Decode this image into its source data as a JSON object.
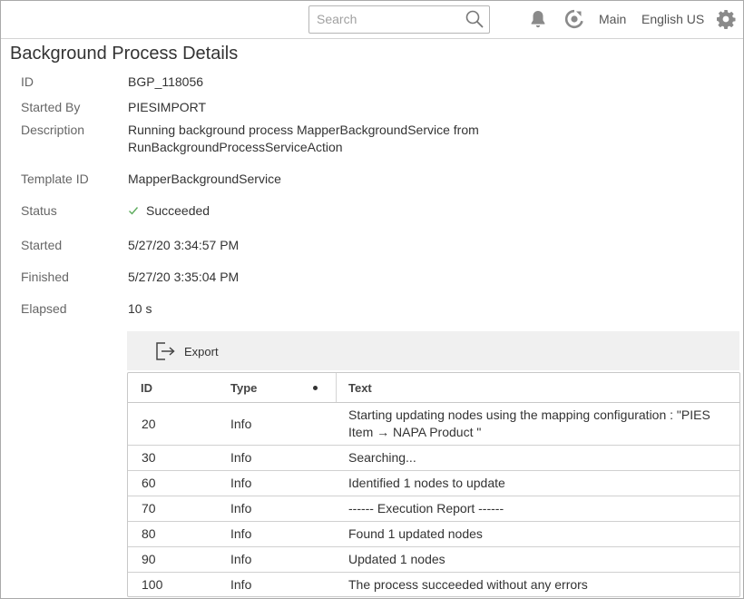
{
  "header": {
    "search_placeholder": "Search",
    "context_label": "Main",
    "language_label": "English US"
  },
  "icons": [
    "search-icon",
    "bell-icon",
    "refresh-icon",
    "gear-icon",
    "export-icon",
    "check-icon"
  ],
  "colors": {
    "success": "#5cab5c",
    "icon_gray": "#8a8a8a",
    "toolbar_bg": "#f0f0f0"
  },
  "page": {
    "title": "Background Process Details",
    "fields": {
      "id": {
        "label": "ID",
        "value": "BGP_118056"
      },
      "started_by": {
        "label": "Started By",
        "value": "PIESIMPORT"
      },
      "description": {
        "label": "Description",
        "line1": "Running background process MapperBackgroundService from",
        "line2": "RunBackgroundProcessServiceAction"
      },
      "template_id": {
        "label": "Template ID",
        "value": "MapperBackgroundService"
      },
      "status": {
        "label": "Status",
        "value": "Succeeded"
      },
      "started": {
        "label": "Started",
        "value": "5/27/20 3:34:57 PM"
      },
      "finished": {
        "label": "Finished",
        "value": "5/27/20 3:35:04 PM"
      },
      "elapsed": {
        "label": "Elapsed",
        "value": "10 s"
      }
    }
  },
  "toolbar": {
    "export_label": "Export"
  },
  "log_table": {
    "columns": [
      "ID",
      "Type",
      "Text"
    ],
    "rows": [
      {
        "id": "20",
        "type": "Info",
        "text_line1": "Starting updating nodes using the mapping configuration : \"PIES",
        "text_line2": "Item → NAPA Product \""
      },
      {
        "id": "30",
        "type": "Info",
        "text_line1": "Searching..."
      },
      {
        "id": "60",
        "type": "Info",
        "text_line1": "Identified 1 nodes to update"
      },
      {
        "id": "70",
        "type": "Info",
        "text_line1": "------ Execution Report ------"
      },
      {
        "id": "80",
        "type": "Info",
        "text_line1": "Found 1 updated nodes"
      },
      {
        "id": "90",
        "type": "Info",
        "text_line1": "Updated 1 nodes"
      },
      {
        "id": "100",
        "type": "Info",
        "text_line1": "The process succeeded without any errors"
      }
    ]
  }
}
